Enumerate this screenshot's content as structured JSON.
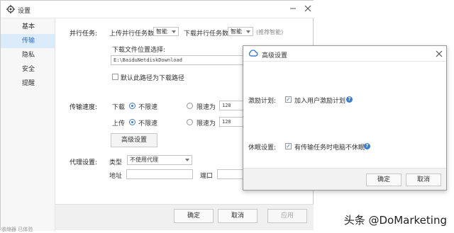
{
  "window": {
    "title": "设置",
    "minimize_icon": "minimize-icon",
    "close_icon": "close-icon"
  },
  "sidebar": {
    "items": [
      {
        "label": "基本"
      },
      {
        "label": "传输"
      },
      {
        "label": "隐私"
      },
      {
        "label": "安全"
      },
      {
        "label": "提醒"
      }
    ],
    "active": 1
  },
  "parallel": {
    "section_label": "并行任务:",
    "upload_label": "上传并行任务数",
    "upload_value": "智能",
    "download_label": "下载并行任务数",
    "download_value": "智能",
    "hint": "(推荐智能)"
  },
  "download_path": {
    "label": "下载文件位置选择:",
    "value": "E:\\BaiduNetdiskDownload",
    "default_checkbox": "默认此路径为下载路径"
  },
  "speed": {
    "section_label": "传输速度:",
    "download_label": "下载",
    "upload_label": "上传",
    "unlimited": "不限速",
    "limit_to": "限速为",
    "download_limit_value": "128",
    "upload_limit_value": "128"
  },
  "advanced_button": "高级设置",
  "proxy": {
    "section_label": "代理设置:",
    "type_label": "类型",
    "type_value": "不使用代理",
    "address_label": "地址",
    "port_label": "端口"
  },
  "footer": {
    "ok": "确定",
    "cancel": "取消",
    "apply": "应用"
  },
  "dialog": {
    "title": "高级设置",
    "incentive_label": "激励计划:",
    "incentive_option": "加入用户激励计划",
    "sleep_label": "休眠设置:",
    "sleep_option": "有传输任务时电脑不休眠",
    "ok": "确定",
    "cancel": "取消"
  },
  "bottom_fragment": "收缩器 已体验",
  "watermark": "头条 @DoMarketing",
  "colors": {
    "accent": "#3a7bd5",
    "sidebar_active_bg": "#dcebfa",
    "sidebar_bg": "#f7f7f7"
  }
}
